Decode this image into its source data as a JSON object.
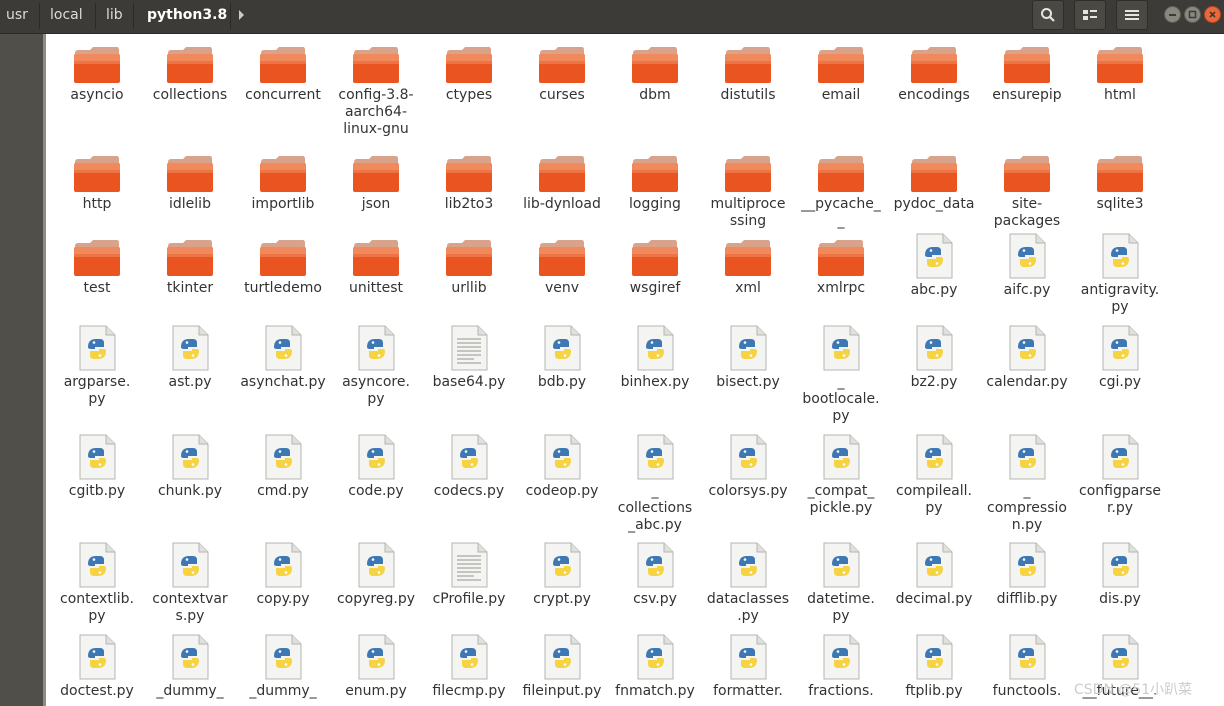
{
  "breadcrumbs": [
    "usr",
    "local",
    "lib",
    "python3.8"
  ],
  "toolbar": {
    "search_icon": "search-icon",
    "view_icon": "list-view-icon",
    "menu_icon": "hamburger-menu-icon"
  },
  "window_controls": [
    "minimize",
    "maximize",
    "close"
  ],
  "colors": {
    "folder_top": "#f08a5d",
    "folder_body": "#e95420",
    "topbar": "#3c3b37",
    "python_blue": "#3d78b4",
    "python_yellow": "#f5d342"
  },
  "rows": [
    [
      {
        "n": "asyncio",
        "t": "folder"
      },
      {
        "n": "collections",
        "t": "folder"
      },
      {
        "n": "concurrent",
        "t": "folder"
      },
      {
        "n": "config-3.8-\naarch64-\nlinux-gnu",
        "t": "folder"
      },
      {
        "n": "ctypes",
        "t": "folder"
      },
      {
        "n": "curses",
        "t": "folder"
      },
      {
        "n": "dbm",
        "t": "folder"
      },
      {
        "n": "distutils",
        "t": "folder"
      },
      {
        "n": "email",
        "t": "folder"
      },
      {
        "n": "encodings",
        "t": "folder"
      },
      {
        "n": "ensurepip",
        "t": "folder"
      },
      {
        "n": "html",
        "t": "folder"
      }
    ],
    [
      {
        "n": "http",
        "t": "folder"
      },
      {
        "n": "idlelib",
        "t": "folder"
      },
      {
        "n": "importlib",
        "t": "folder"
      },
      {
        "n": "json",
        "t": "folder"
      },
      {
        "n": "lib2to3",
        "t": "folder"
      },
      {
        "n": "lib-dynload",
        "t": "folder"
      },
      {
        "n": "logging",
        "t": "folder"
      },
      {
        "n": "multiproce\nssing",
        "t": "folder"
      },
      {
        "n": "__pycache_\n_",
        "t": "folder"
      },
      {
        "n": "pydoc_data",
        "t": "folder"
      },
      {
        "n": "site-\npackages",
        "t": "folder"
      },
      {
        "n": "sqlite3",
        "t": "folder"
      }
    ],
    [
      {
        "n": "test",
        "t": "folder"
      },
      {
        "n": "tkinter",
        "t": "folder"
      },
      {
        "n": "turtledemo",
        "t": "folder"
      },
      {
        "n": "unittest",
        "t": "folder"
      },
      {
        "n": "urllib",
        "t": "folder"
      },
      {
        "n": "venv",
        "t": "folder"
      },
      {
        "n": "wsgiref",
        "t": "folder"
      },
      {
        "n": "xml",
        "t": "folder"
      },
      {
        "n": "xmlrpc",
        "t": "folder"
      },
      {
        "n": "abc.py",
        "t": "py"
      },
      {
        "n": "aifc.py",
        "t": "py"
      },
      {
        "n": "antigravity.\npy",
        "t": "py"
      }
    ],
    [
      {
        "n": "argparse.\npy",
        "t": "py"
      },
      {
        "n": "ast.py",
        "t": "py"
      },
      {
        "n": "asynchat.py",
        "t": "py"
      },
      {
        "n": "asyncore.\npy",
        "t": "py"
      },
      {
        "n": "base64.py",
        "t": "text"
      },
      {
        "n": "bdb.py",
        "t": "py"
      },
      {
        "n": "binhex.py",
        "t": "py"
      },
      {
        "n": "bisect.py",
        "t": "py"
      },
      {
        "n": "_\nbootlocale.\npy",
        "t": "py"
      },
      {
        "n": "bz2.py",
        "t": "py"
      },
      {
        "n": "calendar.py",
        "t": "py"
      },
      {
        "n": "cgi.py",
        "t": "py"
      }
    ],
    [
      {
        "n": "cgitb.py",
        "t": "py"
      },
      {
        "n": "chunk.py",
        "t": "py"
      },
      {
        "n": "cmd.py",
        "t": "py"
      },
      {
        "n": "code.py",
        "t": "py"
      },
      {
        "n": "codecs.py",
        "t": "py"
      },
      {
        "n": "codeop.py",
        "t": "py"
      },
      {
        "n": "_\ncollections\n_abc.py",
        "t": "py"
      },
      {
        "n": "colorsys.py",
        "t": "py"
      },
      {
        "n": "_compat_\npickle.py",
        "t": "py"
      },
      {
        "n": "compileall.\npy",
        "t": "py"
      },
      {
        "n": "_\ncompressio\nn.py",
        "t": "py"
      },
      {
        "n": "configparse\nr.py",
        "t": "py"
      }
    ],
    [
      {
        "n": "contextlib.\npy",
        "t": "py"
      },
      {
        "n": "contextvar\ns.py",
        "t": "py"
      },
      {
        "n": "copy.py",
        "t": "py"
      },
      {
        "n": "copyreg.py",
        "t": "py"
      },
      {
        "n": "cProfile.py",
        "t": "text"
      },
      {
        "n": "crypt.py",
        "t": "py"
      },
      {
        "n": "csv.py",
        "t": "py"
      },
      {
        "n": "dataclasses\n.py",
        "t": "py"
      },
      {
        "n": "datetime.\npy",
        "t": "py"
      },
      {
        "n": "decimal.py",
        "t": "py"
      },
      {
        "n": "difflib.py",
        "t": "py"
      },
      {
        "n": "dis.py",
        "t": "py"
      }
    ],
    [
      {
        "n": "doctest.py",
        "t": "py"
      },
      {
        "n": "_dummy_",
        "t": "py"
      },
      {
        "n": "_dummy_",
        "t": "py"
      },
      {
        "n": "enum.py",
        "t": "py"
      },
      {
        "n": "filecmp.py",
        "t": "py"
      },
      {
        "n": "fileinput.py",
        "t": "py"
      },
      {
        "n": "fnmatch.py",
        "t": "py"
      },
      {
        "n": "formatter.",
        "t": "py"
      },
      {
        "n": "fractions.",
        "t": "py"
      },
      {
        "n": "ftplib.py",
        "t": "py"
      },
      {
        "n": "functools.",
        "t": "py"
      },
      {
        "n": "__future__.",
        "t": "py"
      }
    ]
  ],
  "watermark": "CSDN @51小趴菜"
}
